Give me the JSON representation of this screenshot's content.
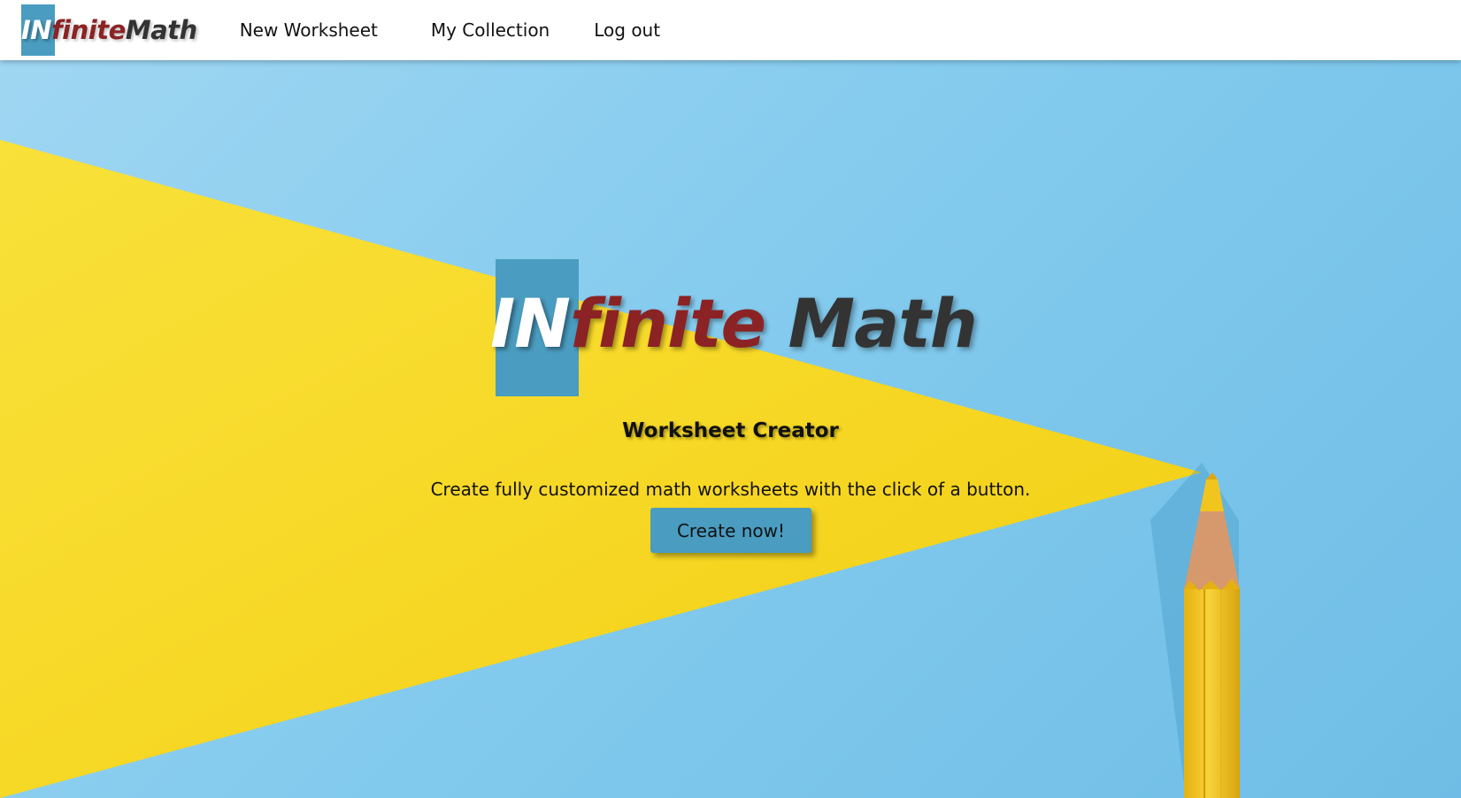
{
  "navbar": {
    "brand": {
      "part_in": "IN",
      "part_finite": "finite",
      "part_math": "Math"
    },
    "links": [
      {
        "label": "New Worksheet"
      },
      {
        "label": "My Collection"
      },
      {
        "label": "Log out"
      }
    ]
  },
  "hero": {
    "logo": {
      "part_in": "IN",
      "part_finite": "finite",
      "part_math": "Math"
    },
    "subtitle": "Worksheet Creator",
    "description": "Create fully customized math worksheets with the click of a button.",
    "cta_label": "Create now!"
  },
  "colors": {
    "accent_blue": "#4a9cc0",
    "brand_red": "#8b2325",
    "brand_dark": "#333333",
    "background_sky": "#7cc6ea",
    "beam_yellow": "#f8dc2e",
    "pencil_yellow": "#f2c51e"
  }
}
